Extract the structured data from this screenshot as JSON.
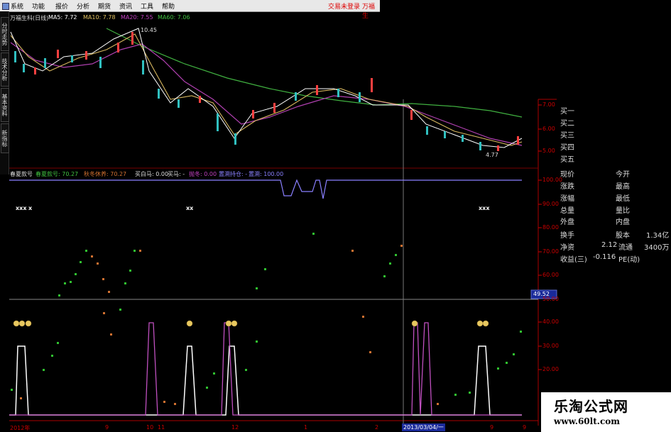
{
  "menu": {
    "items": [
      "系统",
      "功能",
      "报价",
      "分析",
      "期货",
      "资讯",
      "工具",
      "帮助"
    ],
    "login_status": "交易未登录",
    "brand": "万福生"
  },
  "side_tabs": [
    "分时走势",
    "技术分析",
    "基本资料",
    "新指标"
  ],
  "price_panel": {
    "title": "万福生科(日线)",
    "ma5": "MA5: 7.72",
    "ma10": "MA10: 7.78",
    "ma20": "MA20: 7.55",
    "ma60": "MA60: 7.06",
    "high_label": "10.45",
    "low_label": "4.77",
    "axis": [
      "7.00",
      "6.00",
      "5.00"
    ]
  },
  "indicator_panel": {
    "labels": [
      "春夏款号",
      "春夏款号: 70.27",
      "秋冬休养: 70.27",
      "买白马: 0.00",
      "买马: -",
      "抛冬: 0.00",
      "置溯持仓: -",
      "置溯: 100.00"
    ],
    "axis": [
      "100.00",
      "90.00",
      "80.00",
      "70.00",
      "60.00",
      "50.00",
      "40.00",
      "30.00",
      "20.00"
    ],
    "marker": "49.52",
    "xx_marks": [
      "xxx",
      "x",
      "xx",
      "xxx"
    ]
  },
  "quote_panel": {
    "order_rows": [
      "买一",
      "买二",
      "买三",
      "买四",
      "买五"
    ],
    "rows": [
      {
        "k1": "现价",
        "v1": "",
        "k2": "今开",
        "v2": ""
      },
      {
        "k1": "涨跌",
        "v1": "",
        "k2": "最高",
        "v2": ""
      },
      {
        "k1": "涨幅",
        "v1": "",
        "k2": "最低",
        "v2": ""
      },
      {
        "k1": "总量",
        "v1": "",
        "k2": "量比",
        "v2": ""
      },
      {
        "k1": "外盘",
        "v1": "",
        "k2": "内盘",
        "v2": ""
      }
    ],
    "rows2": [
      {
        "k1": "换手",
        "v1": "",
        "k2": "股本",
        "v2": "1.34亿"
      },
      {
        "k1": "净资",
        "v1": "2.12",
        "k2": "流通",
        "v2": "3400万"
      },
      {
        "k1": "收益(三)",
        "v1": "-0.116",
        "k2": "PE(动)",
        "v2": ""
      }
    ]
  },
  "x_axis": [
    "2012年",
    "9",
    "10",
    "11",
    "12",
    "1",
    "2",
    "2013/03/04/一",
    "9",
    "9"
  ],
  "watermark": {
    "title": "乐淘公式网",
    "url": "www.60lt.com"
  },
  "colors": {
    "bg": "#000000",
    "axis_red": "#cc0000",
    "ma5": "#ffffff",
    "ma10": "#e0c060",
    "ma20": "#c040c0",
    "ma60": "#40c040",
    "up": "#ff4040",
    "down": "#30c0c0"
  }
}
